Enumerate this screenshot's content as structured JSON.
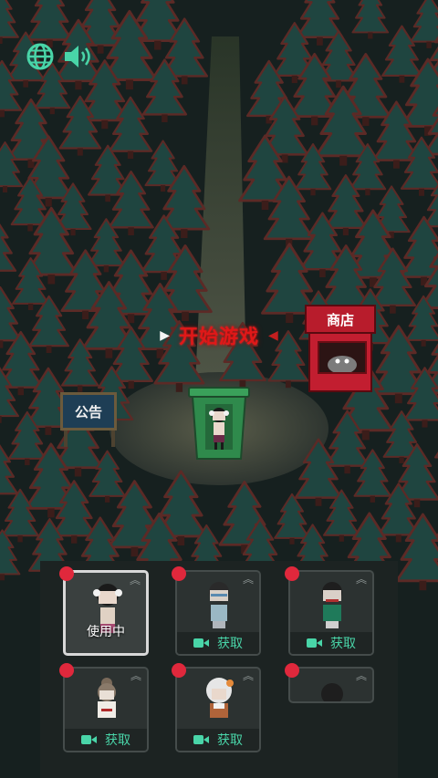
{
  "hud": {
    "language_icon": "globe-icon",
    "sound_icon": "speaker-icon"
  },
  "start": {
    "label": "开始游戏",
    "arrow_left": "▶",
    "arrow_right": "◀"
  },
  "notice_board": {
    "label": "公告"
  },
  "shop": {
    "label": "商店"
  },
  "colors": {
    "accent_red": "#e01818",
    "get_green": "#49d5a8",
    "tree": "#1f4540",
    "tree_edge": "#5c2a26"
  },
  "characters": [
    {
      "status": "使用中",
      "selected": true
    },
    {
      "action": "获取"
    },
    {
      "action": "获取"
    },
    {
      "action": "获取"
    },
    {
      "action": "获取"
    },
    {
      "action": ""
    }
  ]
}
